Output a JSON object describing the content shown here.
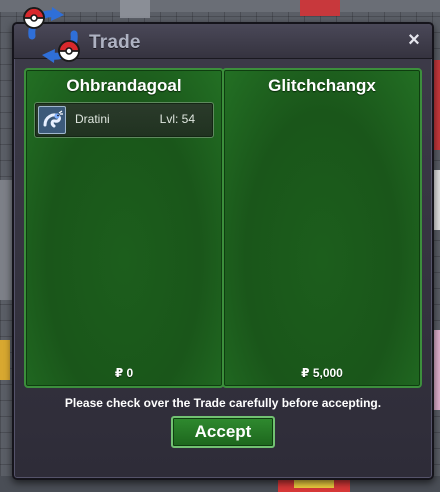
{
  "window": {
    "title": "Trade",
    "close_icon": "×"
  },
  "trade": {
    "left": {
      "player_name": "Ohbrandagoal",
      "items": [
        {
          "name": "Dratini",
          "level": "Lvl: 54",
          "icon": "dratini-icon"
        }
      ],
      "money": "₽ 0"
    },
    "right": {
      "player_name": "Glitchchangx",
      "items": [],
      "money": "₽ 5,000"
    }
  },
  "notice": "Please check over the Trade carefully before accepting.",
  "accept_button": "Accept",
  "colors": {
    "panel_green": "#1c5e1c",
    "panel_border": "#3c8f3c",
    "window_dark": "#35333f",
    "button_green": "#2f8a2f"
  }
}
